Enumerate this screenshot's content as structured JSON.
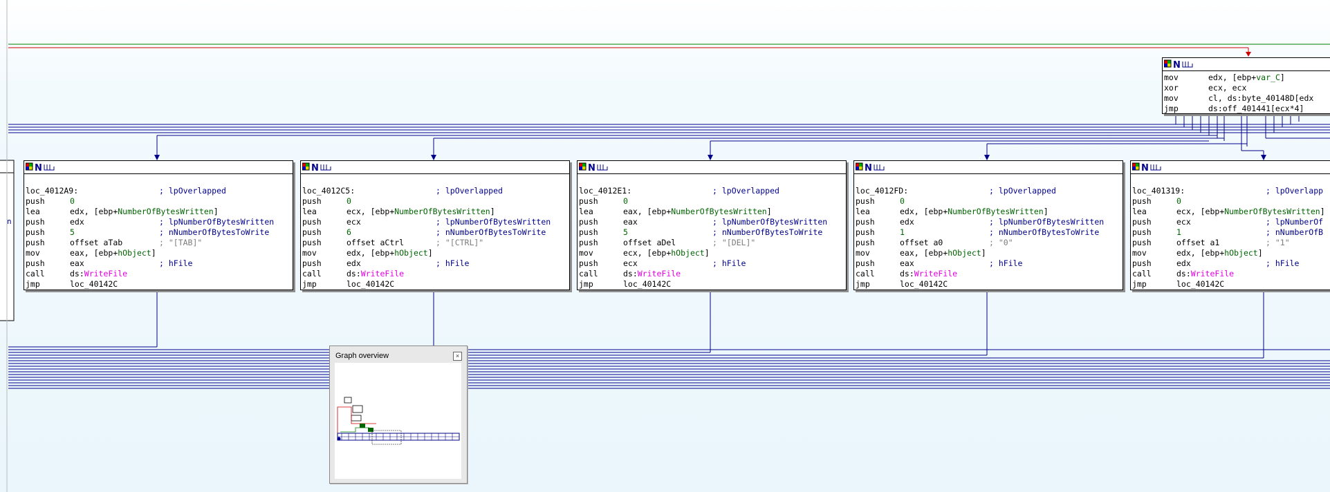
{
  "toolbar_icon_names": [
    "color-icon",
    "n-icon",
    "graph-trace-icon"
  ],
  "node_icon_glyph": "N",
  "top_node": {
    "lines": [
      {
        "mn": "mov",
        "op": "edx, [ebp+",
        "sym": "var_C",
        "tail": "]"
      },
      {
        "mn": "xor",
        "op": "ecx, ecx"
      },
      {
        "mn": "mov",
        "op": "cl, ds:byte_40148D[edx"
      },
      {
        "mn": "jmp",
        "op": "ds:off_401441[ecx*4]"
      }
    ]
  },
  "nodes": [
    {
      "label": "loc_4012A9:",
      "label_comment": "; lpOverlapped",
      "push0": "0",
      "lea_reg": "edx",
      "push_reg": "edx",
      "len": "5",
      "str_name": "aTab",
      "str_val": "; \"[TAB]\"",
      "mov_reg": "eax",
      "push2_reg": "eax",
      "c_written": "; lpNumberOfBytesWritten",
      "c_towrite": "; nNumberOfBytesToWrite",
      "c_hfile": "; hFile",
      "call_target": "WriteFile",
      "jmp_target": "loc_40142C"
    },
    {
      "label": "loc_4012C5:",
      "label_comment": "; lpOverlapped",
      "push0": "0",
      "lea_reg": "ecx",
      "push_reg": "ecx",
      "len": "6",
      "str_name": "aCtrl",
      "str_val": "; \"[CTRL]\"",
      "mov_reg": "edx",
      "push2_reg": "edx",
      "c_written": "; lpNumberOfBytesWritten",
      "c_towrite": "; nNumberOfBytesToWrite",
      "c_hfile": "; hFile",
      "call_target": "WriteFile",
      "jmp_target": "loc_40142C"
    },
    {
      "label": "loc_4012E1:",
      "label_comment": "; lpOverlapped",
      "push0": "0",
      "lea_reg": "eax",
      "push_reg": "eax",
      "len": "5",
      "str_name": "aDel",
      "str_val": "; \"[DEL]\"",
      "mov_reg": "ecx",
      "push2_reg": "ecx",
      "c_written": "; lpNumberOfBytesWritten",
      "c_towrite": "; nNumberOfBytesToWrite",
      "c_hfile": "; hFile",
      "call_target": "WriteFile",
      "jmp_target": "loc_40142C"
    },
    {
      "label": "loc_4012FD:",
      "label_comment": "; lpOverlapped",
      "push0": "0",
      "lea_reg": "edx",
      "push_reg": "edx",
      "len": "1",
      "str_name": "a0",
      "str_val": "; \"0\"",
      "mov_reg": "eax",
      "push2_reg": "eax",
      "c_written": "; lpNumberOfBytesWritten",
      "c_towrite": "; nNumberOfBytesToWrite",
      "c_hfile": "; hFile",
      "call_target": "WriteFile",
      "jmp_target": "loc_40142C"
    },
    {
      "label": "loc_401319:",
      "label_comment": "; lpOverlapp",
      "push0": "0",
      "lea_reg": "ecx",
      "push_reg": "ecx",
      "len": "1",
      "str_name": "a1",
      "str_val": "; \"1\"",
      "mov_reg": "edx",
      "push2_reg": "edx",
      "c_written": "; lpNumberOf",
      "c_towrite": "; nNumberOfB",
      "c_hfile": "; hFile",
      "call_target": "WriteFile",
      "jmp_target": "loc_40142C"
    }
  ],
  "static": {
    "mn_push": "push",
    "mn_lea": "lea",
    "mn_mov": "mov",
    "mn_call": "call",
    "mn_jmp": "jmp",
    "lea_pre": ", [ebp+",
    "lea_sym": "NumberOfBytesWritten",
    "lea_post": "]",
    "mov_pre": ", [ebp+",
    "mov_sym": "hObject",
    "mov_post": "]",
    "offset_kw": "offset ",
    "ds_prefix": "ds:"
  },
  "overview": {
    "title": "Graph overview",
    "close": "×"
  },
  "left_partial_char": "n",
  "colors": {
    "edge": "#00008b",
    "edge_true": "#008000",
    "edge_false": "#cc0000",
    "api": "#e000e0",
    "symbol": "#006400",
    "comment": "#00008b"
  }
}
